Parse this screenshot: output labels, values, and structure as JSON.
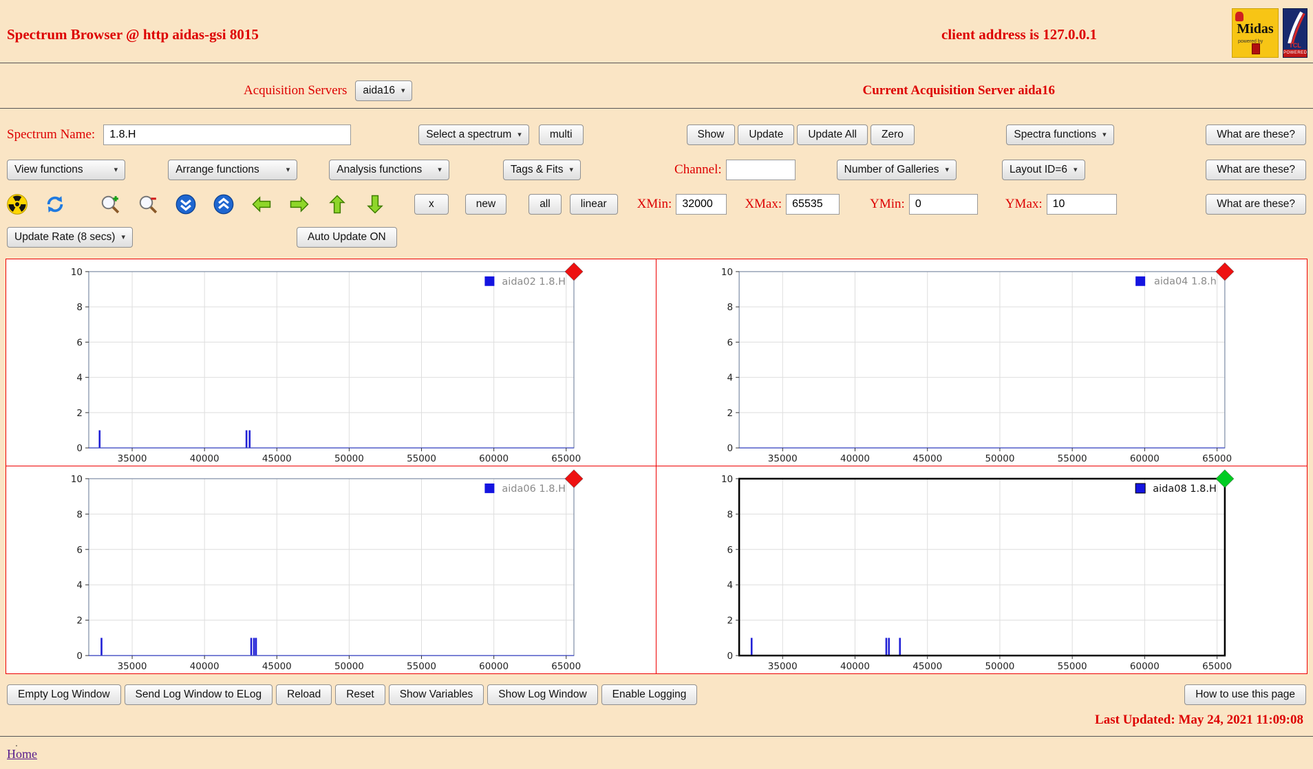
{
  "colors": {
    "background": "#fae5c5",
    "accent_red": "#dd0000",
    "grid_border_red": "#ee0000",
    "spike_blue": "#2121d6",
    "legend_blue": "#1414e0",
    "marker_red": "#ee1111",
    "marker_green": "#00cc22",
    "link_purple": "#551a8b"
  },
  "icons": {
    "chevron": "▾"
  },
  "header": {
    "title": "Spectrum Browser @ http aidas-gsi 8015",
    "client_address": "client address is 127.0.0.1",
    "midas_logo_text": "Midas",
    "midas_powered_text": "powered by",
    "tcl_logo_text": "TCL",
    "tcl_powered_text": "POWERED"
  },
  "server_row": {
    "label": "Acquisition Servers",
    "selected_server": "aida16",
    "current_server": "Current Acquisition Server aida16"
  },
  "spectrum_row": {
    "name_label": "Spectrum Name:",
    "name_value": "1.8.H",
    "select_spectrum_label": "Select a spectrum",
    "multi_label": "multi",
    "show_label": "Show",
    "update_label": "Update",
    "update_all_label": "Update All",
    "zero_label": "Zero",
    "spectra_functions_label": "Spectra functions",
    "what_are_these_label": "What are these?"
  },
  "functions_row": {
    "view_functions_label": "View functions",
    "arrange_functions_label": "Arrange functions",
    "analysis_functions_label": "Analysis functions",
    "tags_fits_label": "Tags & Fits",
    "channel_label": "Channel:",
    "channel_value": "",
    "galleries_label": "Number of Galleries",
    "layout_label": "Layout ID=6",
    "what_are_these_label": "What are these?"
  },
  "toolbar_row": {
    "icon_names": [
      "radioactive-icon",
      "refresh-icon",
      "zoom-in-icon",
      "zoom-out-icon",
      "scroll-down-icon",
      "scroll-up-icon",
      "pan-left-icon",
      "pan-right-icon",
      "pan-up-icon",
      "pan-down-icon"
    ],
    "x_label": "x",
    "new_label": "new",
    "all_label": "all",
    "linear_label": "linear",
    "xmin_label": "XMin:",
    "xmin_value": "32000",
    "xmax_label": "XMax:",
    "xmax_value": "65535",
    "ymin_label": "YMin:",
    "ymin_value": "0",
    "ymax_label": "YMax:",
    "ymax_value": "10",
    "what_are_these_label": "What are these?"
  },
  "update_row": {
    "update_rate_label": "Update Rate (8 secs)",
    "auto_update_label": "Auto Update ON"
  },
  "chart_data": [
    {
      "type": "bar",
      "legend": "aida02 1.8.H",
      "legend_color": "#8a8a8a",
      "xlim": [
        32000,
        65535
      ],
      "ylim": [
        0,
        10
      ],
      "xticks": [
        35000,
        40000,
        45000,
        50000,
        55000,
        60000,
        65000
      ],
      "yticks": [
        0,
        2,
        4,
        6,
        8,
        10
      ],
      "spikes": [
        {
          "x": 32750,
          "y": 1
        },
        {
          "x": 42900,
          "y": 1
        },
        {
          "x": 43120,
          "y": 1
        }
      ],
      "marker_color": "#ee1111",
      "frame": "normal"
    },
    {
      "type": "bar",
      "legend": "aida04 1.8.h",
      "legend_color": "#8a8a8a",
      "xlim": [
        32000,
        65535
      ],
      "ylim": [
        0,
        10
      ],
      "xticks": [
        35000,
        40000,
        45000,
        50000,
        55000,
        60000,
        65000
      ],
      "yticks": [
        0,
        2,
        4,
        6,
        8,
        10
      ],
      "spikes": [],
      "marker_color": "#ee1111",
      "frame": "normal"
    },
    {
      "type": "bar",
      "legend": "aida06 1.8.H",
      "legend_color": "#8a8a8a",
      "xlim": [
        32000,
        65535
      ],
      "ylim": [
        0,
        10
      ],
      "xticks": [
        35000,
        40000,
        45000,
        50000,
        55000,
        60000,
        65000
      ],
      "yticks": [
        0,
        2,
        4,
        6,
        8,
        10
      ],
      "spikes": [
        {
          "x": 32880,
          "y": 1
        },
        {
          "x": 43230,
          "y": 1
        },
        {
          "x": 43420,
          "y": 1
        },
        {
          "x": 43560,
          "y": 1
        }
      ],
      "marker_color": "#ee1111",
      "frame": "normal"
    },
    {
      "type": "bar",
      "legend": "aida08 1.8.H",
      "legend_color": "#111111",
      "xlim": [
        32000,
        65535
      ],
      "ylim": [
        0,
        10
      ],
      "xticks": [
        35000,
        40000,
        45000,
        50000,
        55000,
        60000,
        65000
      ],
      "yticks": [
        0,
        2,
        4,
        6,
        8,
        10
      ],
      "spikes": [
        {
          "x": 32860,
          "y": 1
        },
        {
          "x": 42160,
          "y": 1
        },
        {
          "x": 42340,
          "y": 1
        },
        {
          "x": 43100,
          "y": 1
        }
      ],
      "marker_color": "#00cc22",
      "frame": "highlight"
    }
  ],
  "footer": {
    "buttons": [
      "Empty Log Window",
      "Send Log Window to ELog",
      "Reload",
      "Reset",
      "Show Variables",
      "Show Log Window",
      "Enable Logging"
    ],
    "help_label": "How to use this page",
    "last_updated": "Last Updated: May 24, 2021 11:09:08",
    "dot": ".",
    "home_label": "Home"
  }
}
